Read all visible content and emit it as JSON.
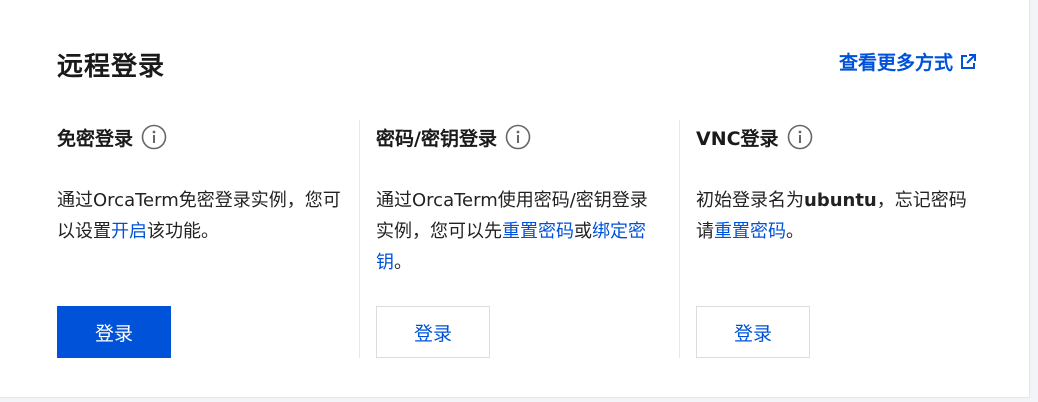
{
  "panel": {
    "title": "远程登录",
    "more_link": "查看更多方式"
  },
  "columns": [
    {
      "title": "免密登录",
      "desc_parts": [
        "通过OrcaTerm免密登录实例，您可以设置",
        "开启",
        "该功能。"
      ],
      "button": "登录"
    },
    {
      "title": "密码/密钥登录",
      "desc_parts": [
        "通过OrcaTerm使用密码/密钥登录实例，您可以先",
        "重置密码",
        "或",
        "绑定密钥",
        "。"
      ],
      "button": "登录"
    },
    {
      "title": "VNC登录",
      "desc_parts": [
        "初始登录名为",
        "ubuntu",
        "，忘记密码请",
        "重置密码",
        "。"
      ],
      "button": "登录"
    }
  ],
  "colors": {
    "accent": "#0052d9",
    "text": "#222222",
    "divider": "#e8e8e8"
  },
  "icons": {
    "info": "info-circle-icon",
    "external": "external-link-icon"
  }
}
